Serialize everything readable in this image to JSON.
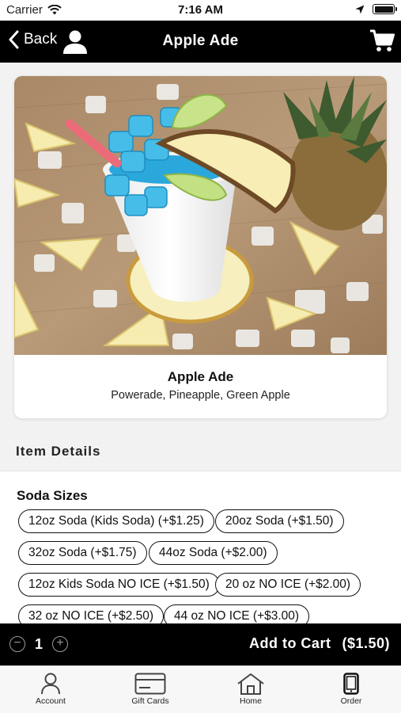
{
  "status_bar": {
    "carrier": "Carrier",
    "time": "7:16 AM"
  },
  "nav": {
    "back_label": "Back",
    "title": "Apple Ade"
  },
  "product": {
    "name": "Apple Ade",
    "description": "Powerade, Pineapple, Green Apple"
  },
  "details": {
    "heading": "Item Details",
    "group_title": "Soda Sizes",
    "options": [
      "12oz Soda (Kids Soda) (+$1.25)",
      "20oz Soda (+$1.50)",
      "32oz Soda (+$1.75)",
      "44oz Soda (+$2.00)",
      "12oz Kids Soda NO ICE (+$1.50)",
      "20 oz NO ICE (+$2.00)",
      "32 oz NO ICE (+$2.50)",
      "44 oz NO ICE (+$3.00)"
    ]
  },
  "cart": {
    "quantity": "1",
    "add_label": "Add to Cart",
    "price": "($1.50)"
  },
  "tabs": [
    {
      "label": "Account",
      "icon": "person-icon"
    },
    {
      "label": "Gift Cards",
      "icon": "gift-card-icon"
    },
    {
      "label": "Home",
      "icon": "home-icon"
    },
    {
      "label": "Order",
      "icon": "phone-icon"
    }
  ],
  "colors": {
    "nav": "#000000",
    "accent_drink": "#2aa8dc",
    "pineapple": "#f4e7a1"
  }
}
